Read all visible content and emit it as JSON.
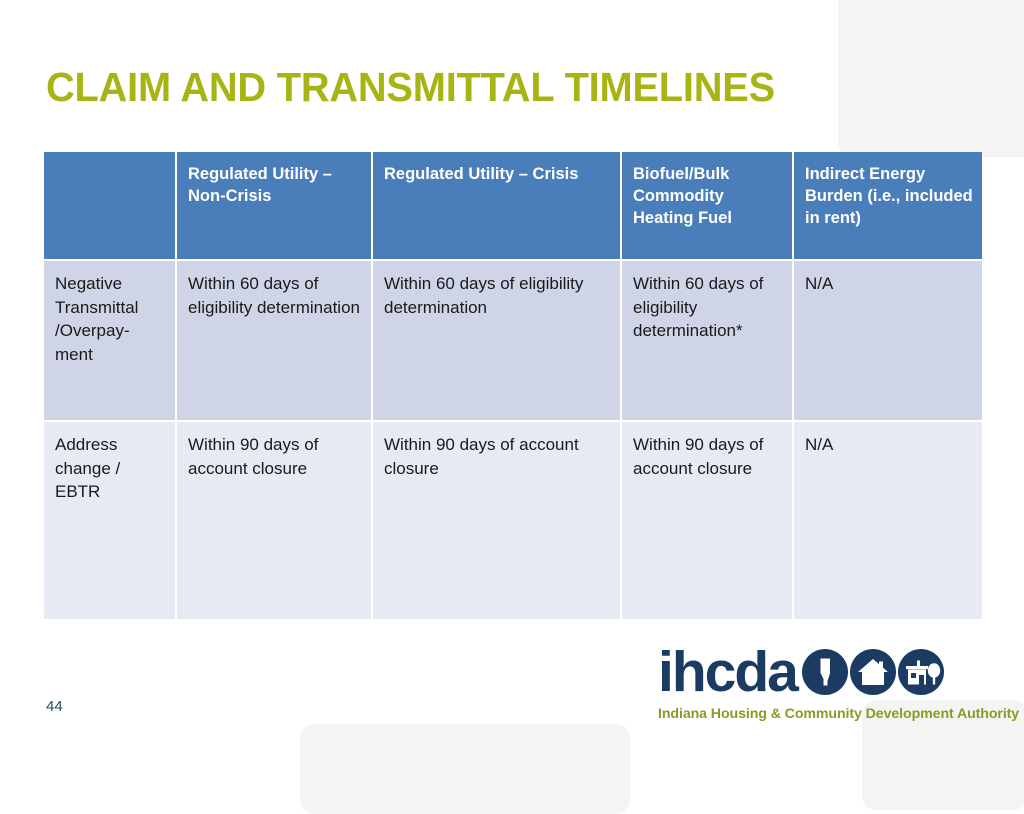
{
  "slide": {
    "title": "CLAIM AND TRANSMITTAL TIMELINES",
    "page_number": "44",
    "title_color": "#a7b414",
    "header_color": "#4a7ebb",
    "row_a_color": "#cfd5e7",
    "row_b_color": "#e7eaf3"
  },
  "table": {
    "headers": [
      "",
      "Regulated Utility – Non-Crisis",
      "Regulated Utility – Crisis",
      "Biofuel/Bulk Commodity Heating Fuel",
      "Indirect Energy Burden (i.e., included in rent)"
    ],
    "rows": [
      {
        "label": "Negative Transmittal /Overpay-ment",
        "cells": [
          "Within 60 days of eligibility determination",
          "Within 60 days of eligibility determination",
          "Within 60 days of eligibility determination*",
          "N/A"
        ]
      },
      {
        "label": "Address change / EBTR",
        "cells": [
          "Within 90 days of account closure",
          "Within 90 days of account closure",
          "Within 90 days of account closure",
          "N/A"
        ]
      }
    ]
  },
  "logo": {
    "wordmark": "ihcda",
    "tagline": "Indiana Housing & Community Development Authority",
    "icon_color": "#1b3b62",
    "tagline_color": "#8a9a24",
    "icons": [
      "indiana-state-icon",
      "house-icon",
      "storefront-icon"
    ]
  }
}
